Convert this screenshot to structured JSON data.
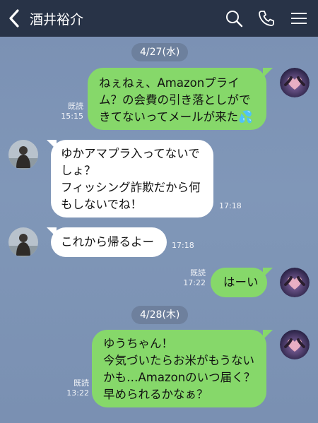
{
  "header": {
    "title": "酒井裕介",
    "icons": [
      "back-chevron-icon",
      "search-icon",
      "phone-icon",
      "menu-icon"
    ],
    "bg_color": "#283347"
  },
  "colors": {
    "chat_bg": "#7d93b5",
    "my_bubble": "#86d86a",
    "their_bubble": "#ffffff"
  },
  "dates": [
    {
      "label": "4/27(水)"
    },
    {
      "label": "4/28(木)"
    }
  ],
  "messages": [
    {
      "side": "me",
      "text": "ねぇねぇ、Amazonプライ\nム？の会費の引き落としがで\nきてないってメールが来た💦",
      "read": "既読",
      "time": "15:15"
    },
    {
      "side": "them",
      "text": "ゆかアマプラ入ってないで\nしょ？\nフィッシング詐欺だから何\nもしないでね！",
      "time": "17:18"
    },
    {
      "side": "them",
      "text": "これから帰るよー",
      "time": "17:18"
    },
    {
      "side": "me",
      "text": "はーい",
      "read": "既読",
      "time": "17:22"
    },
    {
      "side": "me",
      "text": "ゆうちゃん！\n今気づいたらお米がもうない\nかも…Amazonのいつ届く？\n早められるかなぁ？",
      "read": "既読",
      "time": "13:22"
    }
  ]
}
